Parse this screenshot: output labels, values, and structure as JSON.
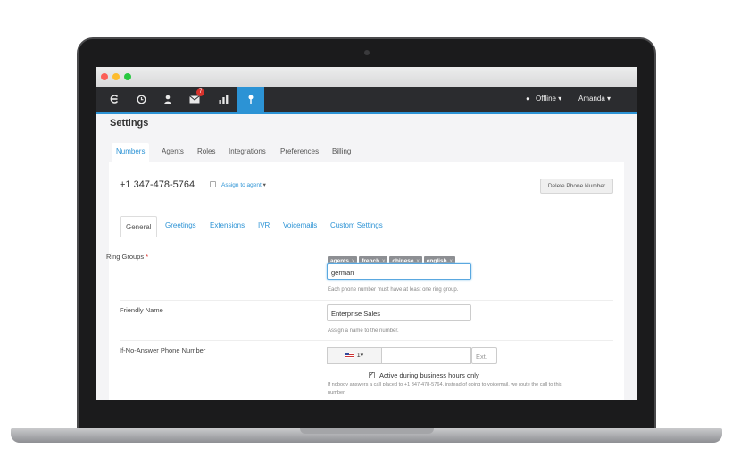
{
  "nav": {
    "mail_badge": "7",
    "status_label": "Offline",
    "user_label": "Amanda"
  },
  "page": {
    "title": "Settings"
  },
  "tabs": [
    {
      "label": "Numbers",
      "active": true
    },
    {
      "label": "Agents"
    },
    {
      "label": "Roles"
    },
    {
      "label": "Integrations"
    },
    {
      "label": "Preferences"
    },
    {
      "label": "Billing"
    }
  ],
  "number": {
    "phone": "+1 347-478-5764",
    "assign_label": "Assign to agent",
    "delete_label": "Delete Phone Number"
  },
  "subtabs": [
    {
      "label": "General",
      "active": true
    },
    {
      "label": "Greetings"
    },
    {
      "label": "Extensions"
    },
    {
      "label": "IVR"
    },
    {
      "label": "Voicemails"
    },
    {
      "label": "Custom Settings"
    }
  ],
  "ring_groups": {
    "label": "Ring Groups",
    "required_mark": "*",
    "tags": [
      "agents",
      "french",
      "chinese",
      "english"
    ],
    "tag_remove": "x",
    "input_value": "german",
    "help": "Each phone number must have at least one ring group."
  },
  "friendly_name": {
    "label": "Friendly Name",
    "value": "Enterprise Sales",
    "help": "Assign a name to the number."
  },
  "no_answer": {
    "label": "If-No-Answer Phone Number",
    "country_code": "1",
    "ext_placeholder": "Ext.",
    "active_label": "Active during business hours only",
    "active_checked": true,
    "help_line1": "If nobody answers a call placed to +1 347-478-5764, instead of going to voicemail, we route the call to this",
    "help_line2": "number."
  },
  "colors": {
    "accent": "#2c93d5",
    "nav_bg": "#2b2c2f",
    "badge": "#d8322c"
  }
}
